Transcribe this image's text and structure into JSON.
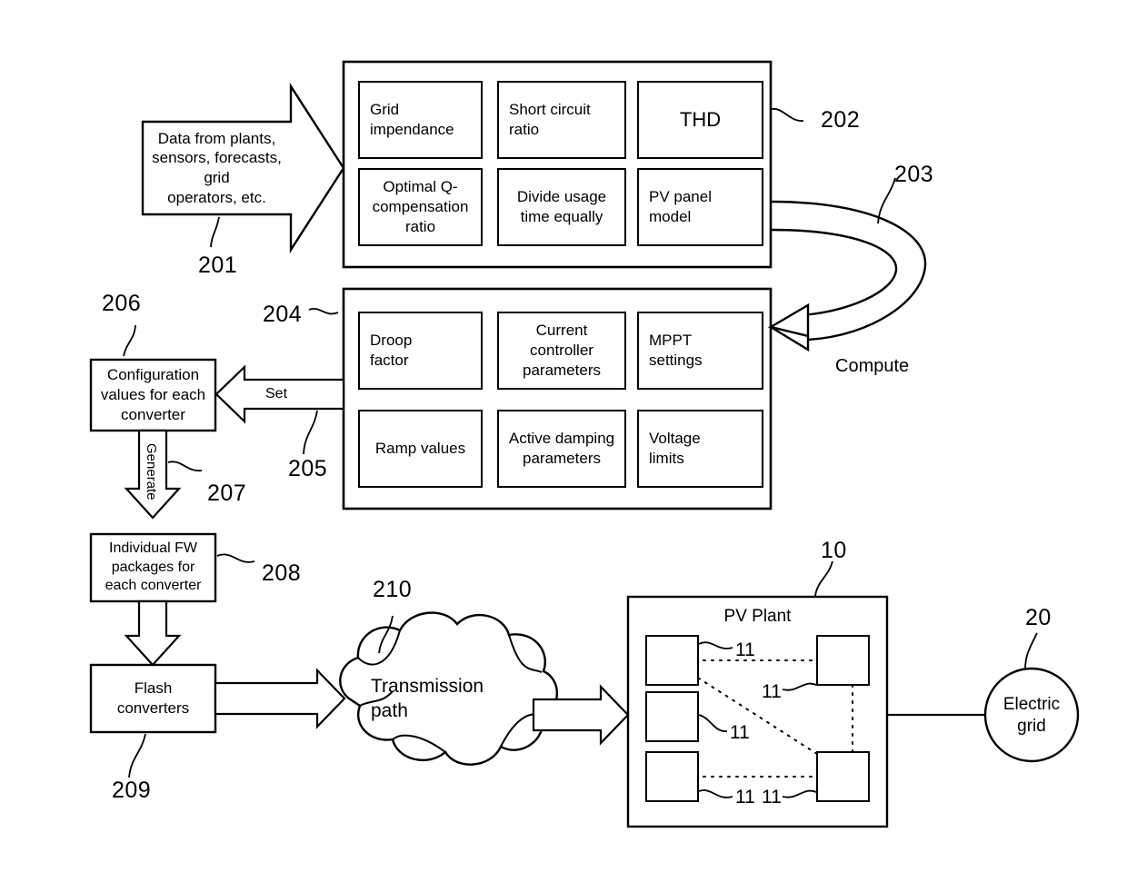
{
  "figure": {
    "type": "patent-block-diagram",
    "background": "#ffffff",
    "stroke": "#000000"
  },
  "input_arrow": {
    "ref": "201",
    "text": "Data from plants,\nsensors, forecasts, grid\noperators, etc."
  },
  "panel_202": {
    "ref": "202",
    "cells": [
      {
        "label": "Grid\nimpendance"
      },
      {
        "label": "Short circuit\nratio"
      },
      {
        "label": "THD"
      },
      {
        "label": "Optimal Q-\ncompensation\nratio"
      },
      {
        "label": "Divide usage\ntime equally"
      },
      {
        "label": "PV panel\nmodel"
      }
    ]
  },
  "compute_loop": {
    "ref": "203",
    "label": "Compute"
  },
  "panel_204": {
    "ref": "204",
    "cells": [
      {
        "label": "Droop\nfactor"
      },
      {
        "label": "Current\ncontroller\nparameters"
      },
      {
        "label": "MPPT\nsettings"
      },
      {
        "label": "Ramp values"
      },
      {
        "label": "Active damping\nparameters"
      },
      {
        "label": "Voltage\nlimits"
      }
    ]
  },
  "set_arrow": {
    "ref": "205",
    "label": "Set"
  },
  "config_box": {
    "ref": "206",
    "label": "Configuration\nvalues for each\nconverter"
  },
  "generate_arrow": {
    "ref": "207",
    "label": "Generate"
  },
  "fw_box": {
    "ref": "208",
    "label": "Individual FW\npackages for\neach converter"
  },
  "flash_box": {
    "ref": "209",
    "label": "Flash\nconverters"
  },
  "cloud": {
    "ref": "210",
    "label": "Transmission\npath"
  },
  "pv_plant": {
    "ref": "10",
    "title": "PV Plant",
    "converter_ref": "11",
    "converter_refs": [
      "11",
      "11",
      "11",
      "11",
      "11"
    ]
  },
  "electric_grid": {
    "ref": "20",
    "label": "Electric\ngrid"
  }
}
